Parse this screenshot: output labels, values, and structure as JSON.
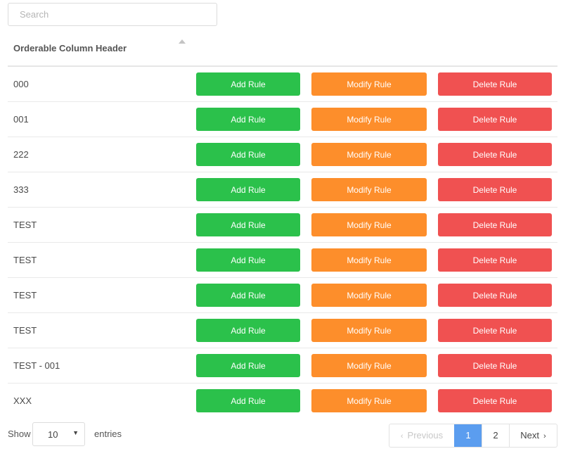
{
  "search": {
    "placeholder": "Search",
    "value": ""
  },
  "table": {
    "header": "Orderable Column Header",
    "rows": [
      {
        "name": "000"
      },
      {
        "name": "001"
      },
      {
        "name": "222"
      },
      {
        "name": "333"
      },
      {
        "name": "TEST"
      },
      {
        "name": "TEST"
      },
      {
        "name": "TEST"
      },
      {
        "name": "TEST"
      },
      {
        "name": "TEST - 001"
      },
      {
        "name": "XXX"
      }
    ],
    "actions": {
      "add": "Add Rule",
      "modify": "Modify Rule",
      "delete": "Delete Rule"
    }
  },
  "footer": {
    "show_label": "Show",
    "entries_value": "10",
    "entries_label": "entries",
    "pagination": {
      "previous": "Previous",
      "pages": [
        "1",
        "2"
      ],
      "active_page": "1",
      "next": "Next"
    }
  },
  "colors": {
    "add": "#2bc14b",
    "modify": "#fd8e2b",
    "delete": "#f05151",
    "active_page": "#5b9def"
  },
  "icons": {
    "sort": "sort-up-icon",
    "select_caret": "caret-down-icon",
    "prev": "chevron-left-icon",
    "next": "chevron-right-icon"
  }
}
